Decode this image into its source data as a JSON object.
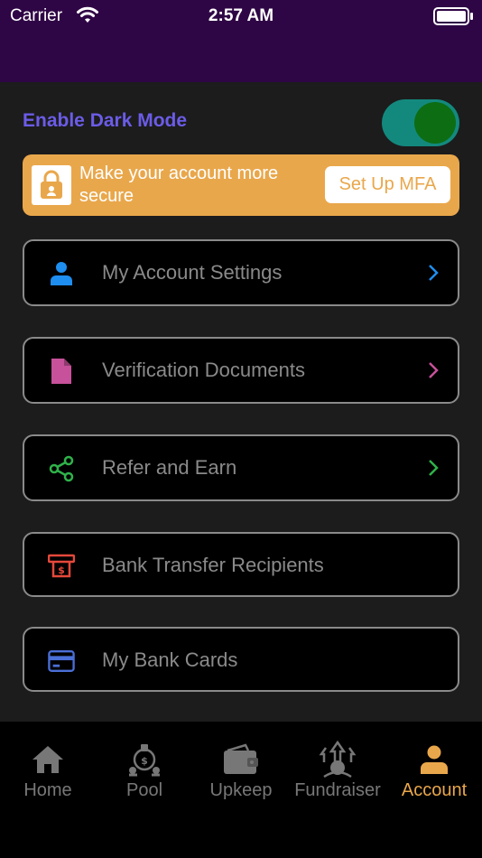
{
  "status_bar": {
    "carrier": "Carrier",
    "time": "2:57 AM"
  },
  "dark_mode": {
    "label": "Enable Dark Mode",
    "enabled": true,
    "toggle_track_color": "#13897e",
    "toggle_knob_color": "#0c6d13"
  },
  "mfa_banner": {
    "message": "Make your account more secure",
    "button_label": "Set Up MFA",
    "background_color": "#e9a74b"
  },
  "menu": {
    "items": [
      {
        "label": "My Account Settings",
        "icon": "person-icon",
        "icon_color": "#1e8ef0",
        "has_chevron": true
      },
      {
        "label": "Verification Documents",
        "icon": "document-icon",
        "icon_color": "#c7519a",
        "has_chevron": true
      },
      {
        "label": "Refer and Earn",
        "icon": "share-icon",
        "icon_color": "#2fb24a",
        "has_chevron": true
      },
      {
        "label": "Bank Transfer Recipients",
        "icon": "bank-transfer-icon",
        "icon_color": "#e5483b",
        "has_chevron": false
      },
      {
        "label": "My Bank Cards",
        "icon": "credit-card-icon",
        "icon_color": "#4a6fd6",
        "has_chevron": false
      }
    ]
  },
  "tab_bar": {
    "tabs": [
      {
        "label": "Home",
        "icon": "home-icon",
        "active": false
      },
      {
        "label": "Pool",
        "icon": "pool-icon",
        "active": false
      },
      {
        "label": "Upkeep",
        "icon": "wallet-icon",
        "active": false
      },
      {
        "label": "Fundraiser",
        "icon": "fundraiser-icon",
        "active": false
      },
      {
        "label": "Account",
        "icon": "account-icon",
        "active": true
      }
    ],
    "active_color": "#e9a74b",
    "inactive_color": "#777777"
  },
  "colors": {
    "header_purple": "#2f0645",
    "accent_purple": "#6b5ce7"
  }
}
